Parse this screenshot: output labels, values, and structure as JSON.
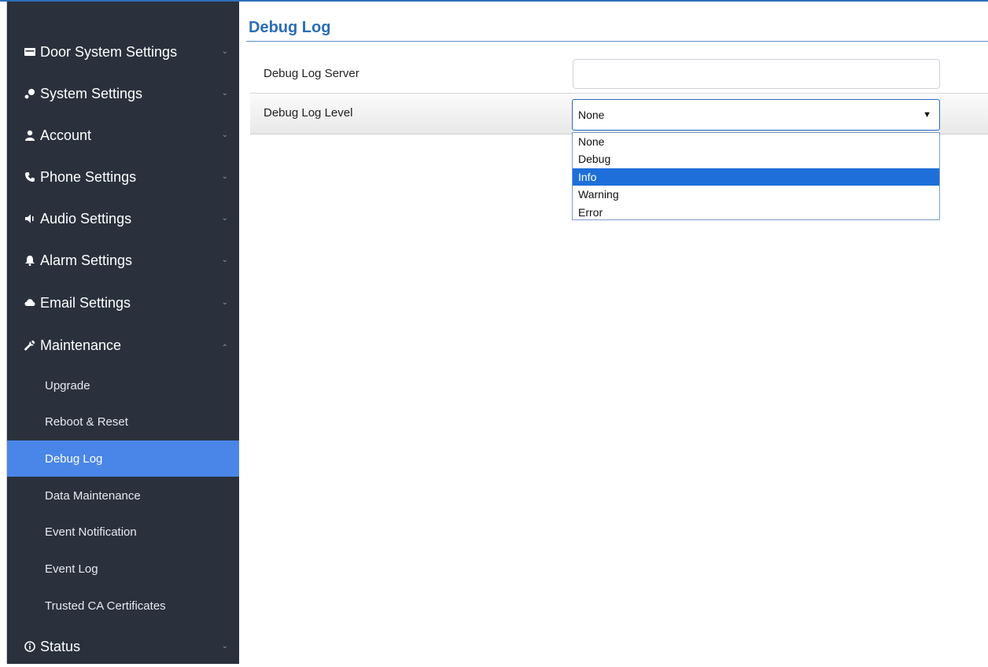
{
  "page": {
    "title": "Debug Log"
  },
  "sidebar": {
    "items": [
      {
        "label": "Door System Settings",
        "icon": "card-icon",
        "expanded": false
      },
      {
        "label": "System Settings",
        "icon": "wrench-key-icon",
        "expanded": false
      },
      {
        "label": "Account",
        "icon": "user-icon",
        "expanded": false
      },
      {
        "label": "Phone Settings",
        "icon": "phone-icon",
        "expanded": false
      },
      {
        "label": "Audio Settings",
        "icon": "speaker-icon",
        "expanded": false
      },
      {
        "label": "Alarm Settings",
        "icon": "bell-icon",
        "expanded": false
      },
      {
        "label": "Email Settings",
        "icon": "cloud-icon",
        "expanded": false
      },
      {
        "label": "Maintenance",
        "icon": "wrench-icon",
        "expanded": true
      },
      {
        "label": "Status",
        "icon": "info-icon",
        "expanded": false
      }
    ],
    "maintenance_sub": [
      {
        "label": "Upgrade",
        "active": false
      },
      {
        "label": "Reboot & Reset",
        "active": false
      },
      {
        "label": "Debug Log",
        "active": true
      },
      {
        "label": "Data Maintenance",
        "active": false
      },
      {
        "label": "Event Notification",
        "active": false
      },
      {
        "label": "Event Log",
        "active": false
      },
      {
        "label": "Trusted CA Certificates",
        "active": false
      }
    ]
  },
  "form": {
    "server_label": "Debug Log Server",
    "server_value": "",
    "level_label": "Debug Log Level",
    "level_value": "None",
    "level_options": [
      "None",
      "Debug",
      "Info",
      "Warning",
      "Error"
    ],
    "highlighted_option": "Info"
  },
  "colors": {
    "sidebar_bg": "#2a313d",
    "active_bg": "#4a86e8",
    "title": "#2a6db5",
    "option_highlight": "#1e6fd9"
  }
}
